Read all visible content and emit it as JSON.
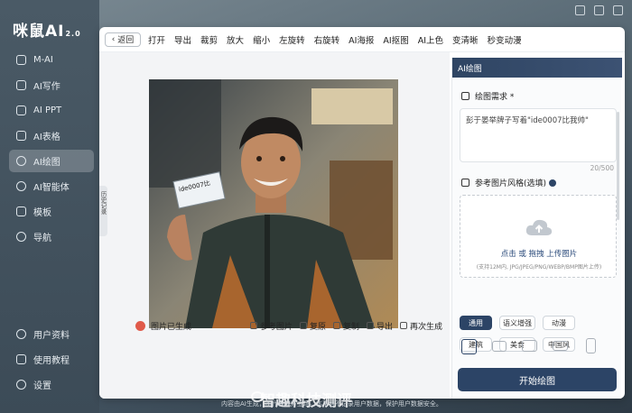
{
  "app": {
    "logo": "咪鼠AI",
    "logo_version": "2.0"
  },
  "sidebar": {
    "items": [
      {
        "label": "M-AI",
        "icon": "ai-chip-icon"
      },
      {
        "label": "AI写作",
        "icon": "pen-icon"
      },
      {
        "label": "AI PPT",
        "icon": "ppt-icon"
      },
      {
        "label": "AI表格",
        "icon": "table-icon"
      },
      {
        "label": "AI绘图",
        "icon": "palette-icon",
        "active": true
      },
      {
        "label": "AI智能体",
        "icon": "robot-icon"
      },
      {
        "label": "模板",
        "icon": "template-icon"
      },
      {
        "label": "导航",
        "icon": "compass-icon"
      }
    ],
    "bottom": [
      {
        "label": "用户资料",
        "icon": "user-icon"
      },
      {
        "label": "使用教程",
        "icon": "book-icon"
      },
      {
        "label": "设置",
        "icon": "gear-icon"
      }
    ]
  },
  "toolbar": {
    "back": "返回",
    "tools": [
      "打开",
      "导出",
      "裁剪",
      "放大",
      "缩小",
      "左旋转",
      "右旋转",
      "AI海报",
      "AI抠图",
      "AI上色",
      "变清晰",
      "秒变动漫"
    ]
  },
  "canvas": {
    "collapse_label": "历史记录",
    "photo_sign_text": "ide0007比"
  },
  "bottom_bar": {
    "status": "图片已生成",
    "actions": [
      "参考图片",
      "复原",
      "复制",
      "导出",
      "再次生成"
    ]
  },
  "right_panel": {
    "title": "AI绘图",
    "prompt_label": "绘图需求 *",
    "prompt_value": "彭于晏举牌子写着\"ide0007比我帅\"",
    "counter": "20/500",
    "ref_label": "参考图片风格(选填)",
    "upload_main": "点击 或 拖拽 上传图片",
    "upload_sub": "(支持12M内, JPG/JPEG/PNG/WEBP/BMP图片上传)",
    "styles": [
      "通用",
      "语义增强",
      "动漫",
      "建筑",
      "美食",
      "中国风"
    ],
    "selected_style": "通用",
    "start_button": "开始绘图"
  },
  "footer": {
    "disclaimer": "内容由AI生成，不代表我方立场。本平台不记录用户数据，保护用户数据安全。",
    "watermark": "智趣科技测评"
  },
  "colors": {
    "accent": "#2c4466",
    "sidebar": "#44535f"
  }
}
